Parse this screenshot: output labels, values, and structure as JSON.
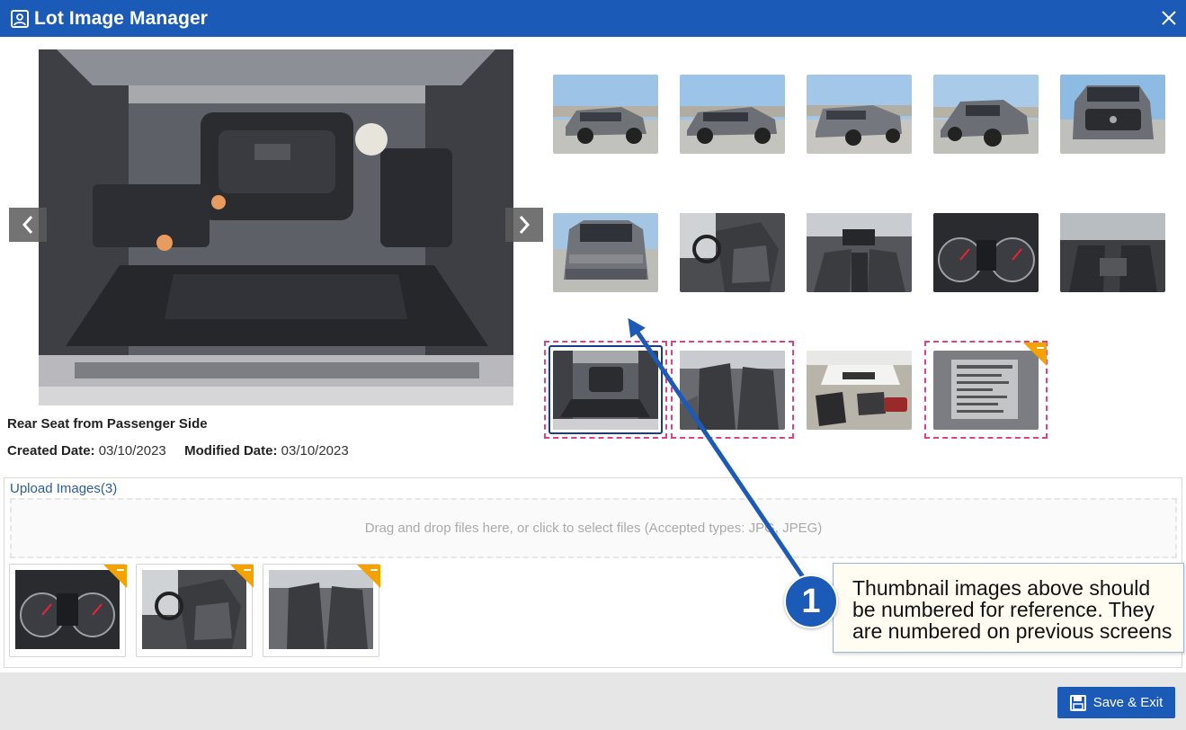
{
  "header": {
    "title": "Lot Image Manager",
    "close_label": "×"
  },
  "viewer": {
    "caption": "Rear Seat from Passenger Side",
    "created_label": "Created Date:",
    "created_value": "03/10/2023",
    "modified_label": "Modified Date:",
    "modified_value": "03/10/2023"
  },
  "upload": {
    "link_label": "Upload Images(3)",
    "dropzone_text": "Drag and drop files here, or click to select files (Accepted types: JPG, JPEG)"
  },
  "footer": {
    "save_label": "Save & Exit"
  },
  "annotation": {
    "number": "1",
    "text": "Thumbnail images above should be numbered for reference. They are numbered on previous screens"
  },
  "colors": {
    "header_bg": "#1c5ab8",
    "marker_dashed": "#e0408a",
    "corner_flag": "#f5a100",
    "link": "#2a5da8"
  }
}
